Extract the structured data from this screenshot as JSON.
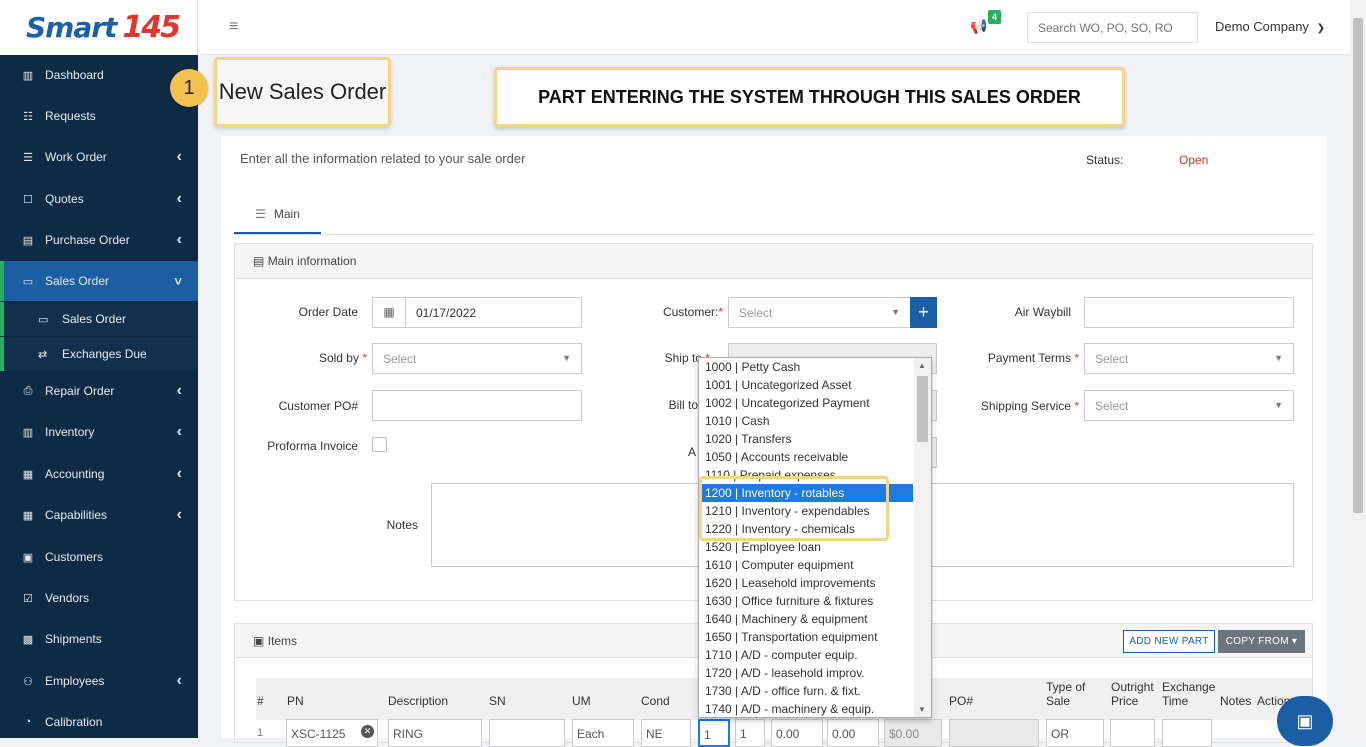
{
  "logo": {
    "word": "Smart",
    "num": "145"
  },
  "nav": {
    "items": [
      {
        "label": "Dashboard",
        "icon": "dashboard-icon",
        "chev": false
      },
      {
        "label": "Requests",
        "icon": "document-icon",
        "chev": false
      },
      {
        "label": "Work Order",
        "icon": "list-icon",
        "chev": true
      },
      {
        "label": "Quotes",
        "icon": "quote-icon",
        "chev": true
      },
      {
        "label": "Purchase Order",
        "icon": "cart-icon",
        "chev": true
      },
      {
        "label": "Sales Order",
        "icon": "card-icon",
        "chev": true
      },
      {
        "label": "Repair Order",
        "icon": "printer-icon",
        "chev": true
      },
      {
        "label": "Inventory",
        "icon": "chart-icon",
        "chev": true
      },
      {
        "label": "Accounting",
        "icon": "calculator-icon",
        "chev": true
      },
      {
        "label": "Capabilities",
        "icon": "calendar-icon",
        "chev": true
      },
      {
        "label": "Customers",
        "icon": "people-icon",
        "chev": false
      },
      {
        "label": "Vendors",
        "icon": "checkbox-icon",
        "chev": false
      },
      {
        "label": "Shipments",
        "icon": "truck-icon",
        "chev": false
      },
      {
        "label": "Employees",
        "icon": "group-icon",
        "chev": true
      },
      {
        "label": "Calibration",
        "icon": "gauge-icon",
        "chev": false
      }
    ],
    "sub": [
      {
        "label": "Sales Order",
        "icon": "card-icon"
      },
      {
        "label": "Exchanges Due",
        "icon": "exchange-icon"
      }
    ]
  },
  "topbar": {
    "notif_count": "4",
    "search_placeholder": "Search WO, PO, SO, RO",
    "company": "Demo Company"
  },
  "page": {
    "step": "1",
    "title": "New Sales Order",
    "callout": "PART ENTERING THE SYSTEM THROUGH THIS SALES ORDER",
    "intro": "Enter all the information related to your sale order",
    "status_label": "Status:",
    "status_value": "Open",
    "tab": "Main"
  },
  "main_info": {
    "header": "Main information",
    "order_date_label": "Order Date",
    "order_date": "01/17/2022",
    "customer_label": "Customer:",
    "customer_placeholder": "Select",
    "air_waybill_label": "Air Waybill",
    "sold_by_label": "Sold by",
    "sold_by_placeholder": "Select",
    "ship_to_label": "Ship to",
    "payment_terms_label": "Payment Terms",
    "payment_terms_placeholder": "Select",
    "customer_po_label": "Customer PO#",
    "bill_to_label": "Bill to",
    "shipping_service_label": "Shipping Service",
    "shipping_service_placeholder": "Select",
    "proforma_label": "Proforma Invoice",
    "a_label": "A",
    "notes_label": "Notes"
  },
  "dropdown": {
    "options": [
      "1000 | Petty Cash",
      "1001 | Uncategorized Asset",
      "1002 | Uncategorized Payment",
      "1010 | Cash",
      "1020 | Transfers",
      "1050 | Accounts receivable",
      "1110 | Prepaid expenses",
      "1200 | Inventory - rotables",
      "1210 | Inventory - expendables",
      "1220 | Inventory - chemicals",
      "1520 | Employee loan",
      "1610 | Computer equipment",
      "1620 | Leasehold improvements",
      "1630 | Office furniture & fixtures",
      "1640 | Machinery & equipment",
      "1650 | Transportation equipment",
      "1710 | A/D - computer equip.",
      "1720 | A/D - leasehold improv.",
      "1730 | A/D - office furn. & fixt.",
      "1740 | A/D - machinery & equip."
    ],
    "selected_index": 7
  },
  "items": {
    "header": "Items",
    "add_new_part": "ADD NEW PART",
    "copy_from": "COPY FROM",
    "columns": {
      "num": "#",
      "pn": "PN",
      "description": "Description",
      "sn": "SN",
      "um": "UM",
      "cond": "Cond",
      "po": "PO#",
      "type_of_sale": "Type of Sale",
      "outright_price": "Outright Price",
      "exchange_time": "Exchange Time",
      "notes": "Notes",
      "action": "Action"
    },
    "row": {
      "num": "1",
      "pn": "XSC-1125",
      "description": "RING",
      "um": "Each",
      "cond": "NE",
      "qty": "1",
      "qty2": "1",
      "price1": "0.00",
      "price2": "0.00",
      "total": "$0.00",
      "type": "OR"
    }
  },
  "colors": {
    "sidebar": "#0f2a44",
    "active": "#1b5ea3",
    "accent": "#27ae60",
    "highlight": "#f3d58a",
    "status_open": "#c0392b"
  }
}
